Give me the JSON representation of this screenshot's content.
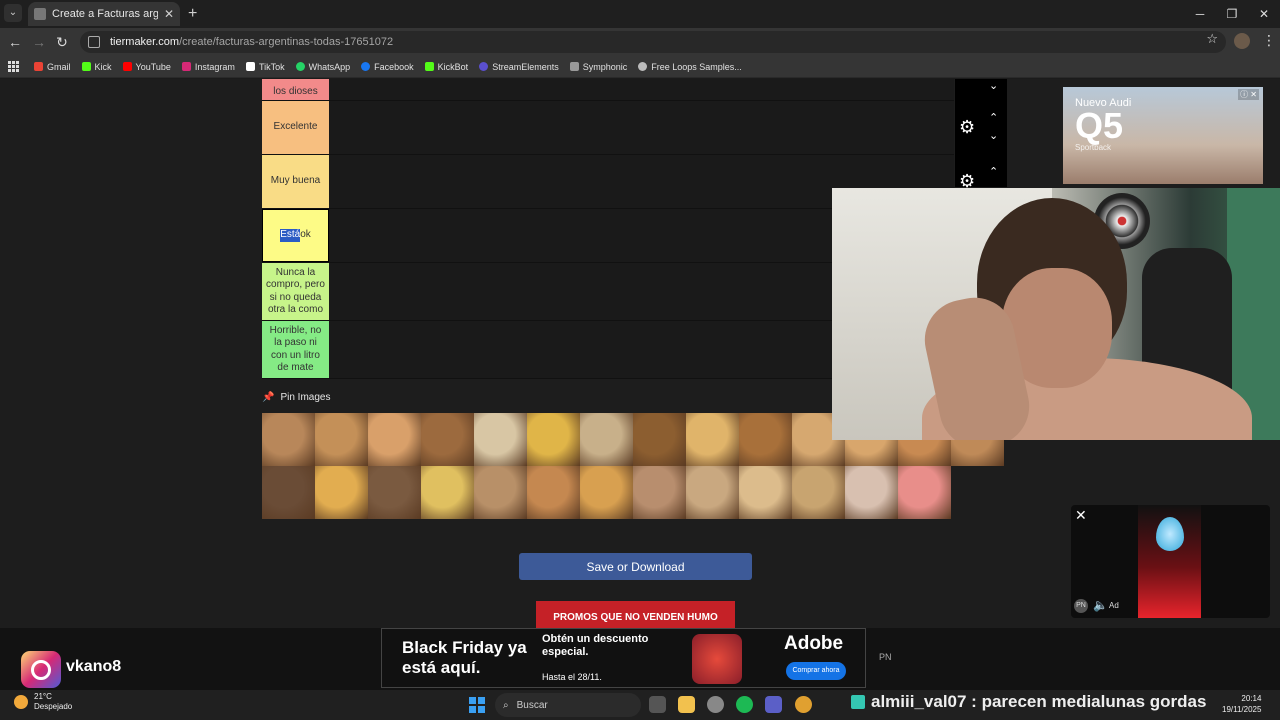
{
  "browser": {
    "tab_title": "Create a Facturas argentinas (Ti",
    "url_host": "tiermaker.com",
    "url_path": "/create/facturas-argentinas-todas-17651072",
    "bookmarks": [
      "Gmail",
      "Kick",
      "YouTube",
      "Instagram",
      "TikTok",
      "WhatsApp",
      "Facebook",
      "KickBot",
      "StreamElements",
      "Symphonic",
      "Free Loops Samples..."
    ]
  },
  "tiers": [
    {
      "label": "los dioses",
      "color": "#f28a8a"
    },
    {
      "label": "Excelente",
      "color": "#f7bf80"
    },
    {
      "label": "Muy buena",
      "color": "#f9dc86"
    },
    {
      "label_selected": "Está",
      "label_rest": " ok",
      "color": "#fdfb86"
    },
    {
      "label": "Nunca la compro, pero si no queda otra la como",
      "color": "#c7f48a"
    },
    {
      "label": "Horrible, no la paso ni con un litro de mate",
      "color": "#85eb85"
    }
  ],
  "pin_images_label": "Pin Images",
  "save_button": "Save or Download",
  "ads": {
    "audi_line1": "Nuevo Audi",
    "audi_model": "Q5",
    "audi_line3": "Sportback",
    "red_banner": "PROMOS QUE NO VENDEN HUMO",
    "video_ad_label": "Ad",
    "video_ad_pn": "PN",
    "adobe_headline": "Black Friday ya está aquí.",
    "adobe_desc": "Obtén un descuento especial.",
    "adobe_until": "Hasta el 28/11.",
    "adobe_brand": "Adobe",
    "adobe_cta": "Comprar ahora",
    "pn_right": "PN"
  },
  "stream": {
    "instagram_user": "vkano8",
    "chat_message": "almiii_val07 : parecen medialunas gordas"
  },
  "taskbar": {
    "temp": "21°C",
    "weather": "Despejado",
    "search_placeholder": "Buscar",
    "time": "20:14",
    "date": "19/11/2025"
  },
  "thumb_colors": [
    "#b8875a",
    "#c49058",
    "#d9a06a",
    "#9c6a3e",
    "#d8c6a4",
    "#e0b548",
    "#c8b08a",
    "#8c5e30",
    "#e0b46a",
    "#a8703a",
    "#d6a870",
    "#d8a66c",
    "#c88a52",
    "#bf8a58",
    "#6a4c36",
    "#e2ad50",
    "#7a5a40",
    "#e0c060",
    "#b89068",
    "#c58850",
    "#d8a050",
    "#b88e6e",
    "#c9a880",
    "#dcbc8c",
    "#c8a470",
    "#d8c0b0",
    "#e88e8a"
  ]
}
